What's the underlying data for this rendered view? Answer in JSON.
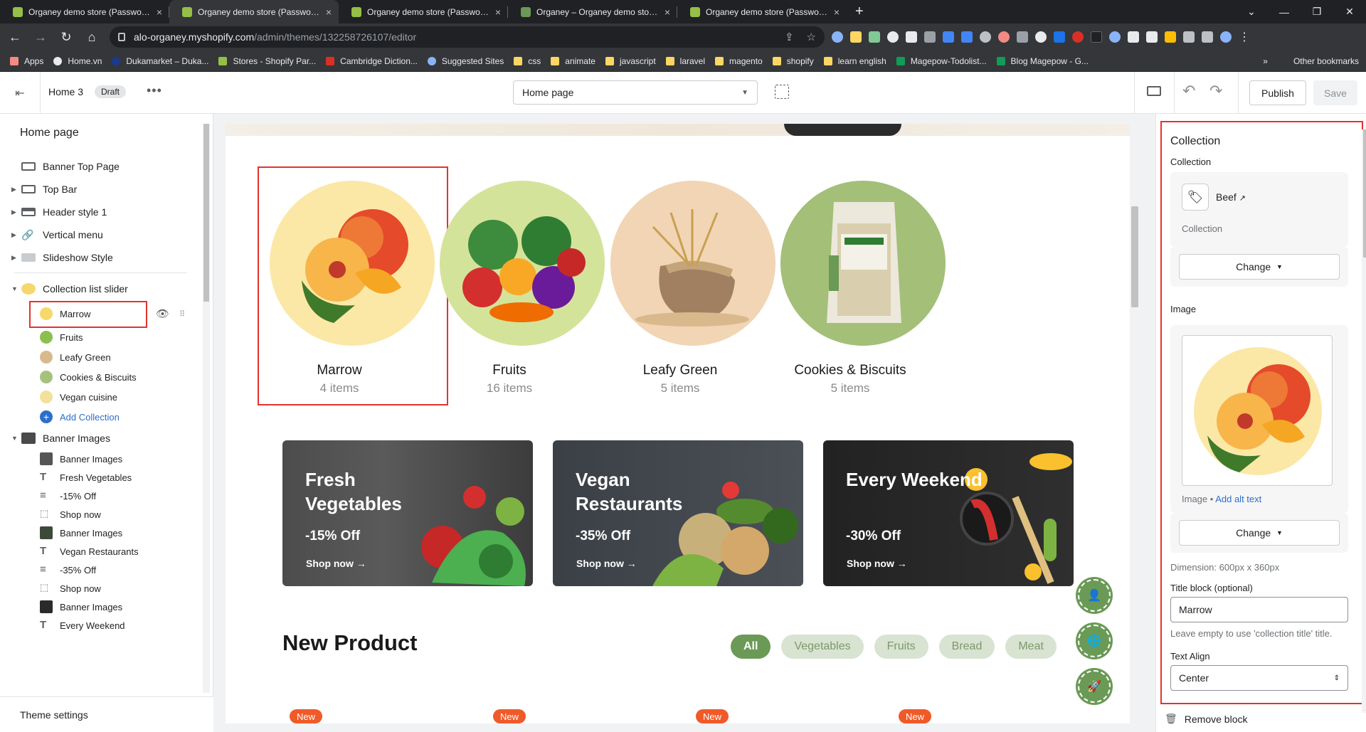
{
  "browser": {
    "tabs": [
      {
        "title": "Organey demo store (Password: a",
        "active": false
      },
      {
        "title": "Organey demo store (Password: a",
        "active": true
      },
      {
        "title": "Organey demo store (Password: a",
        "active": false
      },
      {
        "title": "Organey – Organey demo store (",
        "active": false
      },
      {
        "title": "Organey demo store (Password: a",
        "active": false
      }
    ],
    "url_domain": "alo-organey.myshopify.com",
    "url_path": "/admin/themes/132258726107/editor",
    "bookmarks": [
      "Apps",
      "Home.vn",
      "Dukamarket – Duka...",
      "Stores - Shopify Par...",
      "Cambridge Diction...",
      "Suggested Sites",
      "css",
      "animate",
      "javascript",
      "laravel",
      "magento",
      "shopify",
      "learn english",
      "Magepow-Todolist...",
      "Blog Magepow - G..."
    ],
    "other_bookmarks": "Other bookmarks"
  },
  "editor": {
    "theme_name": "Home 3",
    "status_badge": "Draft",
    "page_selector": "Home page",
    "publish_label": "Publish",
    "save_label": "Save"
  },
  "sidebar": {
    "title": "Home page",
    "sections_top": [
      "Banner Top Page",
      "Top Bar",
      "Header style 1",
      "Vertical menu",
      "Slideshow Style"
    ],
    "collection_section": "Collection list slider",
    "collection_blocks": [
      "Marrow",
      "Fruits",
      "Leafy Green",
      "Cookies & Biscuits",
      "Vegan cuisine"
    ],
    "add_collection": "Add Collection",
    "banner_section": "Banner Images",
    "banner_blocks": [
      "Banner Images",
      "Fresh Vegetables",
      "-15% Off",
      "Shop now",
      "Banner Images",
      "Vegan Restaurants",
      "-35% Off",
      "Shop now",
      "Banner Images",
      "Every Weekend"
    ],
    "theme_settings": "Theme settings"
  },
  "preview": {
    "categories": [
      {
        "name": "Marrow",
        "count": "4 items"
      },
      {
        "name": "Fruits",
        "count": "16 items"
      },
      {
        "name": "Leafy Green",
        "count": "5 items"
      },
      {
        "name": "Cookies & Biscuits",
        "count": "5 items"
      }
    ],
    "banners": [
      {
        "title": "Fresh Vegetables",
        "discount": "-15% Off",
        "cta": "Shop now →"
      },
      {
        "title": "Vegan Restaurants",
        "discount": "-35% Off",
        "cta": "Shop now →"
      },
      {
        "title": "Every Weekend",
        "discount": "-30% Off",
        "cta": "Shop now →"
      }
    ],
    "new_product_title": "New Product",
    "filters": [
      "All",
      "Vegetables",
      "Fruits",
      "Bread",
      "Meat"
    ],
    "new_badge": "New"
  },
  "settings": {
    "title": "Collection",
    "collection_label": "Collection",
    "collection_name": "Beef",
    "collection_sub": "Collection",
    "change_label": "Change",
    "image_label": "Image",
    "image_prefix": "Image •",
    "add_alt_text": "Add alt text",
    "dimension": "Dimension: 600px x 360px",
    "title_block_label": "Title block (optional)",
    "title_block_value": "Marrow",
    "title_block_hint": "Leave empty to use 'collection title' title.",
    "text_align_label": "Text Align",
    "text_align_value": "Center",
    "remove_block": "Remove block"
  },
  "colors": {
    "accent_green": "#6a9a56",
    "highlight_red": "#e5322d",
    "link_blue": "#2c6ecb",
    "badge_orange": "#f05a28"
  }
}
